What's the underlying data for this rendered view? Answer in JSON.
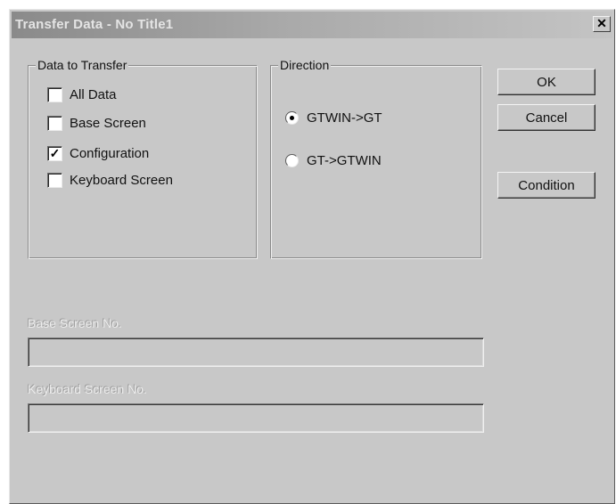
{
  "window": {
    "title": "Transfer Data - No Title1",
    "close_glyph": "✕",
    "close_icon": "close-icon"
  },
  "data_group": {
    "legend": "Data to Transfer",
    "items": [
      {
        "label": "All Data",
        "checked": false
      },
      {
        "label": "Base Screen",
        "checked": false
      },
      {
        "label": "Configuration",
        "checked": true
      },
      {
        "label": "Keyboard Screen",
        "checked": false
      }
    ],
    "check_glyph": "✓"
  },
  "direction_group": {
    "legend": "Direction",
    "options": [
      {
        "label": "GTWIN->GT",
        "selected": true
      },
      {
        "label": "GT->GTWIN",
        "selected": false
      }
    ]
  },
  "buttons": {
    "ok": "OK",
    "cancel": "Cancel",
    "condition": "Condition"
  },
  "fields": {
    "base_screen": {
      "label": "Base Screen No.",
      "value": ""
    },
    "keyboard_screen": {
      "label": "Keyboard Screen No.",
      "value": ""
    }
  },
  "colors": {
    "dialog_bg": "#c8c8c8",
    "disabled_text": "#ededed"
  }
}
